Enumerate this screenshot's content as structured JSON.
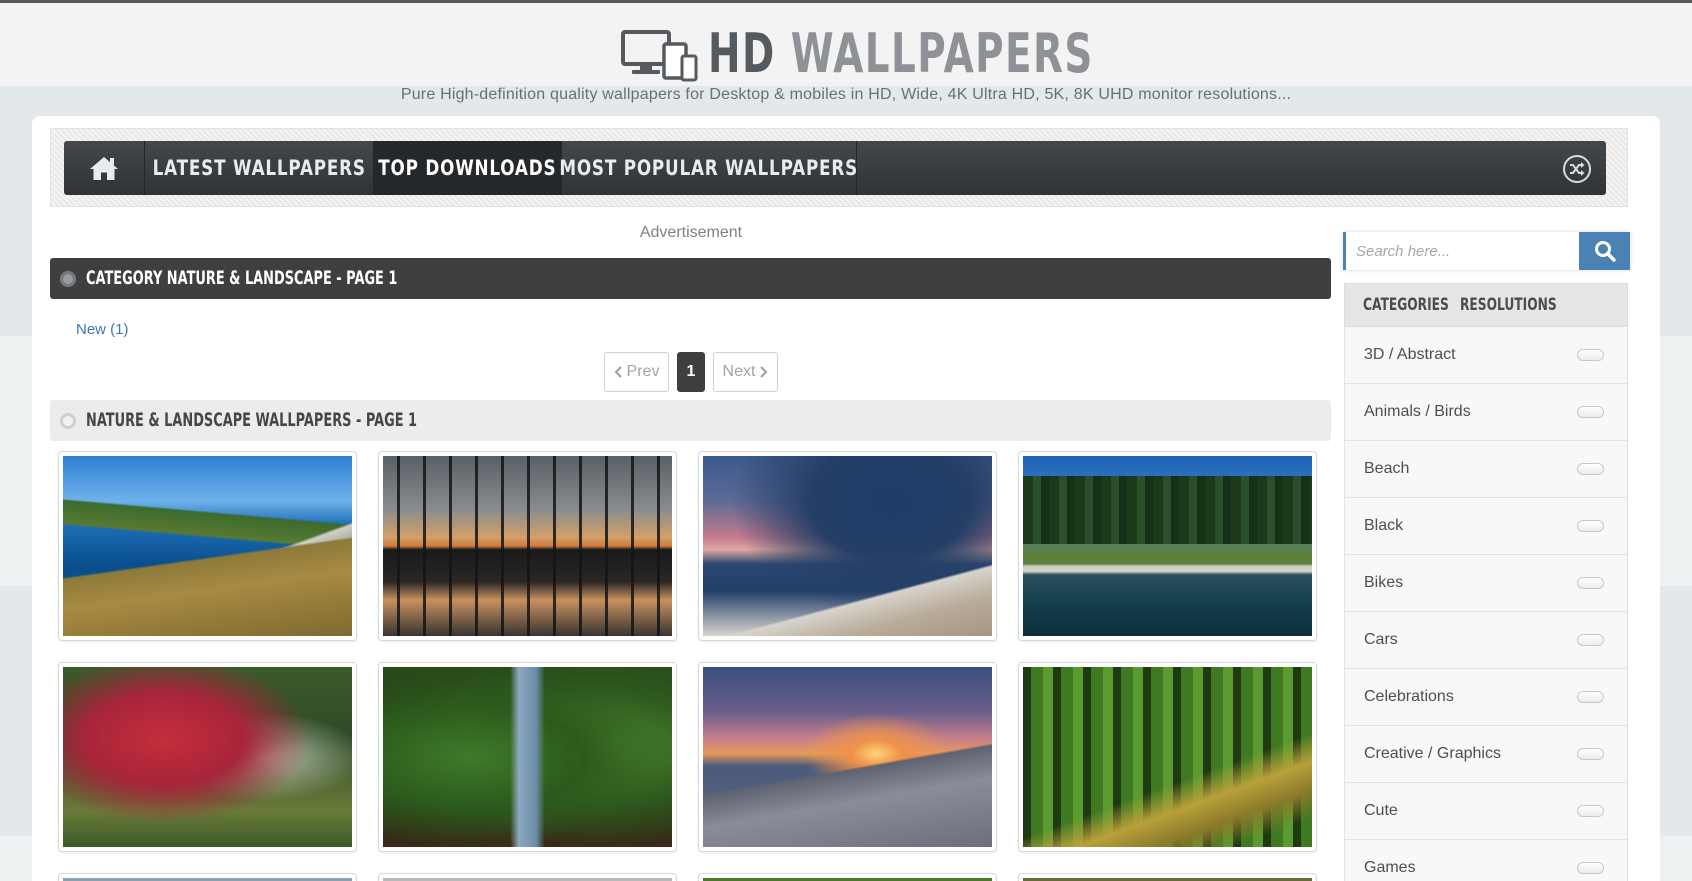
{
  "header": {
    "logo_hd": "HD",
    "logo_wallpapers": "WALLPAPERS",
    "tagline": "Pure High-definition quality wallpapers for Desktop & mobiles in HD, Wide, 4K Ultra HD, 5K, 8K UHD monitor resolutions..."
  },
  "nav": {
    "items": [
      {
        "icon": "home-icon"
      },
      {
        "label": "LATEST WALLPAPERS"
      },
      {
        "label": "TOP DOWNLOADS",
        "active": true
      },
      {
        "label": "MOST POPULAR WALLPAPERS"
      }
    ],
    "shuffle_icon": "shuffle-icon"
  },
  "main": {
    "advertisement": "Advertisement",
    "category_title": "CATEGORY NATURE & LANDSCAPE - PAGE 1",
    "subcategory_link": "New (1)",
    "pagination": {
      "prev": "Prev",
      "current": "1",
      "next": "Next"
    },
    "wallpapers_title": "NATURE & LANDSCAPE WALLPAPERS - PAGE 1",
    "thumbnails": [
      "coastal-cliffs-sea",
      "tree-silhouettes-lake-sunset",
      "storm-clouds-beach",
      "forest-lake",
      "red-autumn-tree-forest",
      "green-forest-stream",
      "rocky-shore-sunset",
      "forest-path"
    ]
  },
  "sidebar": {
    "search_placeholder": "Search here...",
    "tabs": [
      "CATEGORIES",
      "RESOLUTIONS"
    ],
    "categories": [
      "3D / Abstract",
      "Animals / Birds",
      "Beach",
      "Black",
      "Bikes",
      "Cars",
      "Celebrations",
      "Creative / Graphics",
      "Cute",
      "Games"
    ]
  },
  "colors": {
    "accent_blue": "#4a82b4",
    "nav_dark": "#3d3f41",
    "link_blue": "#3b77b5"
  }
}
